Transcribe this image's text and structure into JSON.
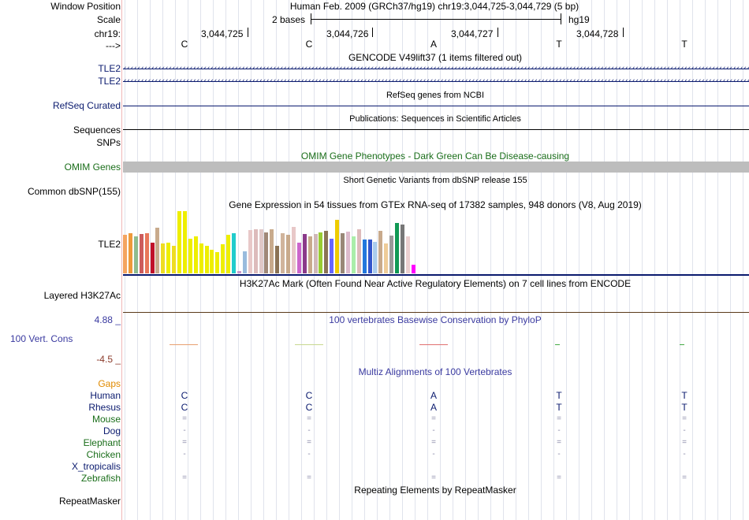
{
  "header": {
    "window_position_label": "Window Position",
    "window_position_value": "Human Feb. 2009 (GRCh37/hg19)   chr19:3,044,725-3,044,729 (5 bp)",
    "scale_label": "Scale",
    "scale_value": "2 bases",
    "scale_assembly": "hg19",
    "chrom_label": "chr19:",
    "strand_label": "--->",
    "positions": [
      "3,044,725",
      "3,044,726",
      "3,044,727",
      "3,044,728"
    ],
    "bases": [
      "C",
      "C",
      "A",
      "T",
      "T"
    ]
  },
  "tracks": {
    "gencode_title": "GENCODE V49lift37 (1 items filtered out)",
    "gencode_items": [
      "TLE2",
      "TLE2"
    ],
    "refseq_label": "RefSeq Curated",
    "refseq_title": "RefSeq genes from NCBI",
    "sequences_label": "Sequences",
    "publications_title": "Publications: Sequences in Scientific Articles",
    "snps_label": "SNPs",
    "omim_title": "OMIM Gene Phenotypes - Dark Green Can Be Disease-causing",
    "omim_label": "OMIM Genes",
    "dbsnp_title": "Short Genetic Variants from dbSNP release 155",
    "dbsnp_label": "Common dbSNP(155)",
    "gtex_title": "Gene Expression in 54 tissues from GTEx RNA-seq of 17382 samples, 948 donors (V8, Aug 2019)",
    "gtex_label": "TLE2",
    "h3k27_title": "H3K27Ac Mark (Often Found Near Active Regulatory Elements) on 7 cell lines from ENCODE",
    "h3k27_label": "Layered H3K27Ac",
    "cons_max": "4.88 _",
    "cons_title": "100 vertebrates Basewise Conservation by PhyloP",
    "cons_label": "100 Vert. Cons",
    "cons_min": "-4.5 _",
    "multiz_title": "Multiz Alignments of 100 Vertebrates",
    "species": [
      {
        "name": "Gaps",
        "glyphs": [
          "",
          "",
          "",
          "",
          ""
        ]
      },
      {
        "name": "Human",
        "glyphs": [
          "C",
          "C",
          "A",
          "T",
          "T"
        ]
      },
      {
        "name": "Rhesus",
        "glyphs": [
          "C",
          "C",
          "A",
          "T",
          "T"
        ]
      },
      {
        "name": "Mouse",
        "glyphs": [
          "=",
          "=",
          "=",
          "=",
          "="
        ]
      },
      {
        "name": "Dog",
        "glyphs": [
          "-",
          "-",
          "-",
          "-",
          "-"
        ]
      },
      {
        "name": "Elephant",
        "glyphs": [
          "=",
          "=",
          "=",
          "=",
          "="
        ]
      },
      {
        "name": "Chicken",
        "glyphs": [
          "-",
          "-",
          "-",
          "-",
          "-"
        ]
      },
      {
        "name": "X_tropicalis",
        "glyphs": [
          "",
          "",
          "",
          "",
          ""
        ]
      },
      {
        "name": "Zebrafish",
        "glyphs": [
          "=",
          "=",
          "=",
          "=",
          "="
        ]
      }
    ],
    "repeat_title": "Repeating Elements by RepeatMasker",
    "repeat_label": "RepeatMasker"
  },
  "gtex_bars": [
    {
      "color": "#f4a460",
      "value": 0.62
    },
    {
      "color": "#ee9a3a",
      "value": 0.64
    },
    {
      "color": "#8fbc8f",
      "value": 0.59
    },
    {
      "color": "#cd5c5c",
      "value": 0.63
    },
    {
      "color": "#e8775a",
      "value": 0.64
    },
    {
      "color": "#c0102a",
      "value": 0.49
    },
    {
      "color": "#c8aa8c",
      "value": 0.73
    },
    {
      "color": "#eedd22",
      "value": 0.48
    },
    {
      "color": "#eeee00",
      "value": 0.49
    },
    {
      "color": "#eedd22",
      "value": 0.44
    },
    {
      "color": "#eeee00",
      "value": 1.0
    },
    {
      "color": "#eeee00",
      "value": 1.0
    },
    {
      "color": "#eeee00",
      "value": 0.56
    },
    {
      "color": "#eeee00",
      "value": 0.6
    },
    {
      "color": "#eeee00",
      "value": 0.48
    },
    {
      "color": "#eeee00",
      "value": 0.44
    },
    {
      "color": "#eeee00",
      "value": 0.38
    },
    {
      "color": "#eeee00",
      "value": 0.34
    },
    {
      "color": "#eeee00",
      "value": 0.47
    },
    {
      "color": "#eeee00",
      "value": 0.62
    },
    {
      "color": "#22cccc",
      "value": 0.65
    },
    {
      "color": "#cc99cc",
      "value": 0.04
    },
    {
      "color": "#99bbdd",
      "value": 0.36
    },
    {
      "color": "#e8c8c8",
      "value": 0.69
    },
    {
      "color": "#ddbbbb",
      "value": 0.71
    },
    {
      "color": "#e0c8c8",
      "value": 0.71
    },
    {
      "color": "#a08878",
      "value": 0.66
    },
    {
      "color": "#c8aa8c",
      "value": 0.71
    },
    {
      "color": "#8b7355",
      "value": 0.44
    },
    {
      "color": "#d0b49c",
      "value": 0.65
    },
    {
      "color": "#c8aa8c",
      "value": 0.62
    },
    {
      "color": "#e8c8c8",
      "value": 0.75
    },
    {
      "color": "#cc66cc",
      "value": 0.49
    },
    {
      "color": "#8b3a8b",
      "value": 0.63
    },
    {
      "color": "#c8aa8c",
      "value": 0.6
    },
    {
      "color": "#d0b8b8",
      "value": 0.63
    },
    {
      "color": "#99cc33",
      "value": 0.66
    },
    {
      "color": "#8b7355",
      "value": 0.68
    },
    {
      "color": "#6666ff",
      "value": 0.56
    },
    {
      "color": "#eecc00",
      "value": 0.86
    },
    {
      "color": "#998877",
      "value": 0.64
    },
    {
      "color": "#ddbbcc",
      "value": 0.67
    },
    {
      "color": "#aaeeaa",
      "value": 0.59
    },
    {
      "color": "#ddbbbb",
      "value": 0.71
    },
    {
      "color": "#2277dd",
      "value": 0.54
    },
    {
      "color": "#3355cc",
      "value": 0.54
    },
    {
      "color": "#aaccee",
      "value": 0.5
    },
    {
      "color": "#c8aa8c",
      "value": 0.68
    },
    {
      "color": "#eecc99",
      "value": 0.48
    },
    {
      "color": "#999999",
      "value": 0.61
    },
    {
      "color": "#119955",
      "value": 0.81
    },
    {
      "color": "#777777",
      "value": 0.79
    },
    {
      "color": "#ebcfcf",
      "value": 0.6
    },
    {
      "color": "#ff00ff",
      "value": 0.14
    }
  ]
}
